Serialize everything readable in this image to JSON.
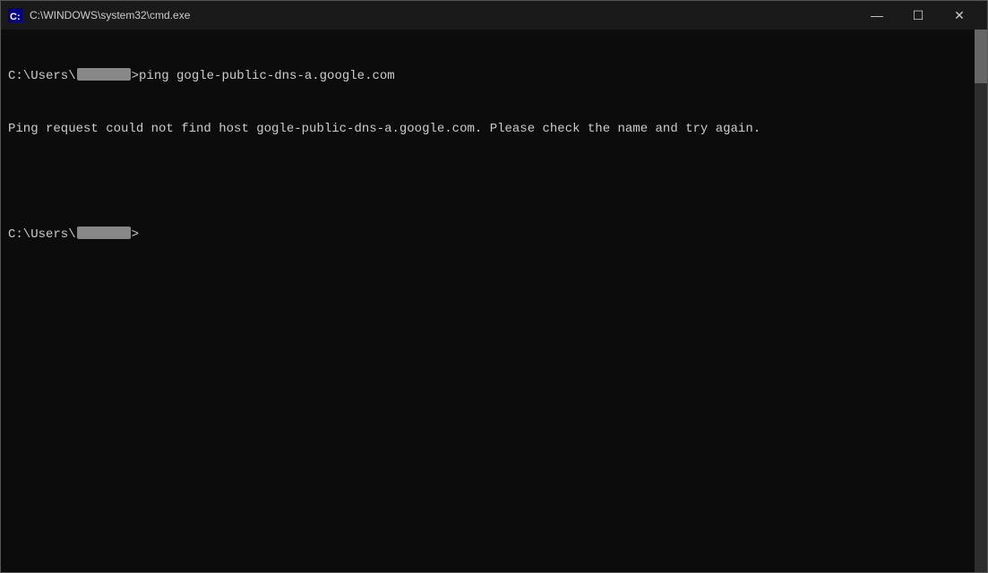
{
  "window": {
    "title": "C:\\WINDOWS\\system32\\cmd.exe",
    "icon": "CMD"
  },
  "title_bar_buttons": {
    "minimize": "—",
    "maximize": "☐",
    "close": "✕"
  },
  "terminal": {
    "lines": [
      {
        "type": "command",
        "prefix": "C:\\Users\\",
        "username_blurred": true,
        "suffix": ">ping gogle-public-dns-a.google.com"
      },
      {
        "type": "output",
        "text": "Ping request could not find host gogle-public-dns-a.google.com. Please check the name and try again."
      },
      {
        "type": "blank"
      },
      {
        "type": "prompt",
        "prefix": "C:\\Users\\",
        "username_blurred": true,
        "suffix": ">"
      }
    ]
  }
}
